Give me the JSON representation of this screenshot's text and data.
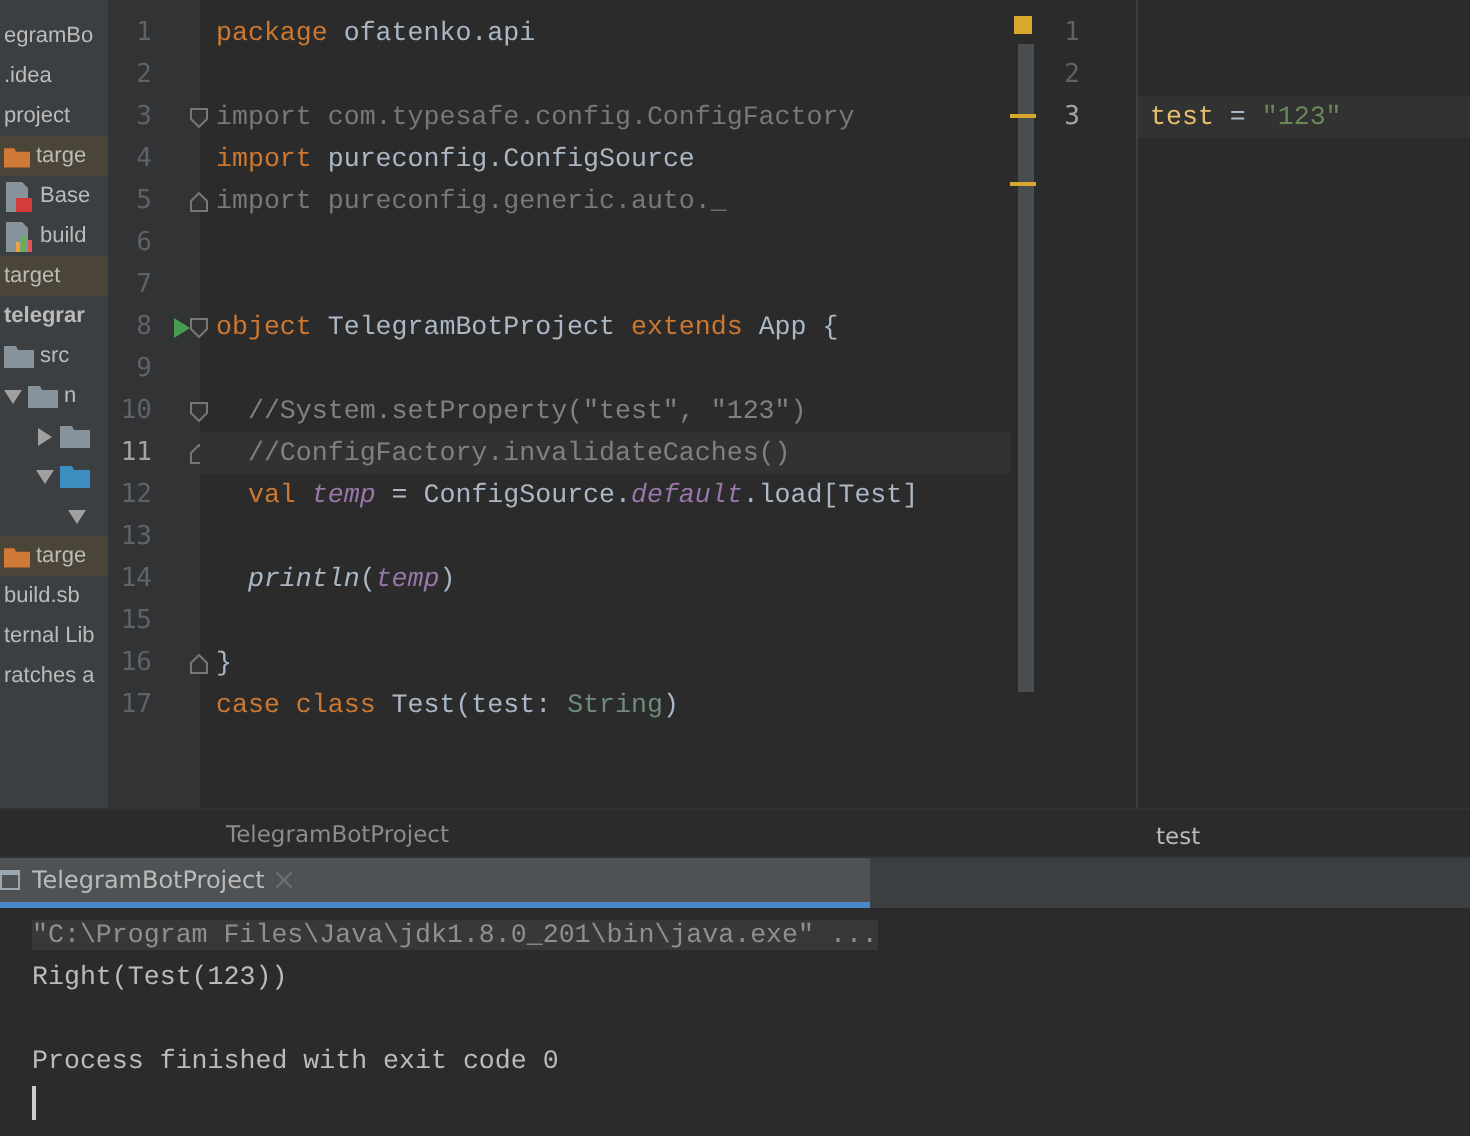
{
  "sidebar": {
    "items": [
      {
        "label": "egramBo",
        "kind": "text",
        "excluded": false,
        "bold": false
      },
      {
        "label": ".idea",
        "kind": "text",
        "excluded": false,
        "bold": false
      },
      {
        "label": "project",
        "kind": "text",
        "excluded": false,
        "bold": false
      },
      {
        "label": "targe",
        "kind": "folder",
        "excluded": true,
        "bold": false
      },
      {
        "label": "Base",
        "kind": "scala-file",
        "excluded": false,
        "bold": false
      },
      {
        "label": "build",
        "kind": "chart-file",
        "excluded": false,
        "bold": false
      },
      {
        "label": "target",
        "kind": "text",
        "excluded": true,
        "bold": false
      },
      {
        "label": "telegrar",
        "kind": "text",
        "excluded": false,
        "bold": true
      },
      {
        "label": "src",
        "kind": "folder",
        "excluded": false,
        "bold": false
      },
      {
        "label": "n",
        "kind": "folder",
        "excluded": false,
        "bold": false,
        "expanded": true,
        "children": [
          {
            "kind": "folder",
            "excluded": false,
            "expanded": false
          },
          {
            "kind": "source-folder",
            "excluded": false,
            "expanded": true,
            "children": [
              {
                "excluded": false,
                "expanded": true
              }
            ]
          }
        ]
      },
      {
        "label": "targe",
        "kind": "folder",
        "excluded": true,
        "bold": false
      },
      {
        "label": "build.sb",
        "kind": "text",
        "excluded": false,
        "bold": false
      },
      {
        "label": "ternal Lib",
        "kind": "text",
        "excluded": false,
        "bold": false
      },
      {
        "label": "ratches a",
        "kind": "text",
        "excluded": false,
        "bold": false
      }
    ]
  },
  "editor": {
    "breadcrumb": "TelegramBotProject",
    "lines": [
      {
        "number": "1",
        "current": false,
        "tokens": [
          {
            "kind": "keyword",
            "text": "package"
          },
          {
            "kind": "plain",
            "text": " ofatenko.api"
          }
        ]
      },
      {
        "number": "2",
        "current": false
      },
      {
        "number": "3",
        "current": false,
        "fold_start": true,
        "tokens": [
          {
            "kind": "unused",
            "text": "import com.typesafe.config.ConfigFactory"
          }
        ]
      },
      {
        "number": "4",
        "current": false,
        "tokens": [
          {
            "kind": "keyword",
            "text": "import"
          },
          {
            "kind": "plain",
            "text": " pureconfig.ConfigSource"
          }
        ]
      },
      {
        "number": "5",
        "current": false,
        "fold_end": true,
        "tokens": [
          {
            "kind": "unused",
            "text": "import pureconfig.generic.auto._"
          }
        ]
      },
      {
        "number": "6",
        "current": false
      },
      {
        "number": "7",
        "current": false
      },
      {
        "number": "8",
        "current": false,
        "run": true,
        "fold_start": true,
        "tokens": [
          {
            "kind": "keyword",
            "text": "object"
          },
          {
            "kind": "plain",
            "text": " TelegramBotProject "
          },
          {
            "kind": "keyword",
            "text": "extends"
          },
          {
            "kind": "plain",
            "text": " App {"
          }
        ]
      },
      {
        "number": "9",
        "current": false
      },
      {
        "number": "10",
        "current": false,
        "fold_start": true,
        "tokens": [
          {
            "kind": "comment",
            "text": "  //System.setProperty(\"test\", \"123\")"
          }
        ]
      },
      {
        "number": "11",
        "current": true,
        "fold_end": true,
        "tokens": [
          {
            "kind": "comment",
            "text": "  //ConfigFactory.invalidateCaches()"
          }
        ]
      },
      {
        "number": "12",
        "current": false,
        "tokens": [
          {
            "kind": "keyword",
            "text": "  val"
          },
          {
            "kind": "field",
            "text": " temp"
          },
          {
            "kind": "plain",
            "text": " = ConfigSource."
          },
          {
            "kind": "field",
            "text": "default"
          },
          {
            "kind": "plain",
            "text": ".load[Test]"
          }
        ]
      },
      {
        "number": "13",
        "current": false
      },
      {
        "number": "14",
        "current": false,
        "tokens": [
          {
            "kind": "function",
            "text": "  println"
          },
          {
            "kind": "plain",
            "text": "("
          },
          {
            "kind": "field",
            "text": "temp"
          },
          {
            "kind": "plain",
            "text": ")"
          }
        ]
      },
      {
        "number": "15",
        "current": false
      },
      {
        "number": "16",
        "current": false,
        "fold_end": true,
        "tokens": [
          {
            "kind": "plain",
            "text": "}"
          }
        ]
      },
      {
        "number": "17",
        "current": false,
        "tokens": [
          {
            "kind": "keyword",
            "text": "case class"
          },
          {
            "kind": "plain",
            "text": " Test(test: "
          },
          {
            "kind": "type",
            "text": "String"
          },
          {
            "kind": "plain",
            "text": ")"
          }
        ]
      }
    ]
  },
  "config_editor": {
    "breadcrumb": "test",
    "lines": [
      {
        "number": "1",
        "current": false
      },
      {
        "number": "2",
        "current": false
      },
      {
        "number": "3",
        "current": true,
        "tokens": [
          {
            "kind": "key",
            "text": "test"
          },
          {
            "kind": "plain",
            "text": " = "
          },
          {
            "kind": "string",
            "text": "\"123\""
          }
        ]
      }
    ]
  },
  "run_panel": {
    "tab": {
      "label": "TelegramBotProject",
      "selected": true
    },
    "lines": [
      {
        "kind": "command",
        "text": "\"C:\\Program Files\\Java\\jdk1.8.0_201\\bin\\java.exe\" ..."
      },
      {
        "kind": "output",
        "text": "Right(Test(123))"
      },
      {
        "kind": "blank"
      },
      {
        "kind": "output",
        "text": "Process finished with exit code 0"
      },
      {
        "kind": "cursor"
      }
    ]
  }
}
